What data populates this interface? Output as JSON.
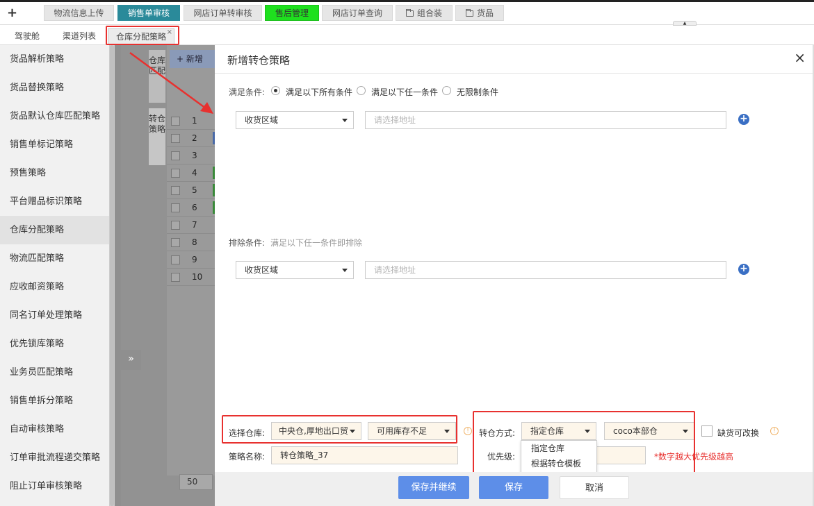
{
  "toolbar": {
    "add_label": "+"
  },
  "top_tabs": [
    {
      "label": "物流信息上传",
      "bg": "#e6e6e6",
      "color": "#555"
    },
    {
      "label": "销售单审核",
      "bg": "#2a8a9a",
      "color": "#ffffff"
    },
    {
      "label": "网店订单转审核",
      "bg": "#e6e6e6",
      "color": "#555"
    },
    {
      "label": "售后管理",
      "bg": "#1ee01e",
      "color": "#333"
    },
    {
      "label": "网店订单查询",
      "bg": "#e6e6e6",
      "color": "#555"
    },
    {
      "label": "组合装",
      "icon": "folder-icon"
    },
    {
      "label": "货品",
      "icon": "folder-icon"
    }
  ],
  "sub_tabs": [
    {
      "label": "驾驶舱"
    },
    {
      "label": "渠道列表"
    },
    {
      "label": "仓库分配策略",
      "close": "×"
    }
  ],
  "sidebar": {
    "items": [
      {
        "label": "货品解析策略"
      },
      {
        "label": "货品替换策略"
      },
      {
        "label": "货品默认仓库匹配策略"
      },
      {
        "label": "销售单标记策略"
      },
      {
        "label": "预售策略"
      },
      {
        "label": "平台赠品标识策略"
      },
      {
        "label": "仓库分配策略",
        "active": true
      },
      {
        "label": "物流匹配策略"
      },
      {
        "label": "应收邮资策略"
      },
      {
        "label": "同名订单处理策略"
      },
      {
        "label": "优先锁库策略"
      },
      {
        "label": "业务员匹配策略"
      },
      {
        "label": "销售单拆分策略"
      },
      {
        "label": "自动审核策略"
      },
      {
        "label": "订单审批流程递交策略"
      },
      {
        "label": "阻止订单审核策略"
      }
    ],
    "expand_label": "»"
  },
  "background": {
    "vtab1": "仓库匹配",
    "vtab2": "转仓策略",
    "new_label": "+ 新增",
    "rows": [
      "1",
      "2",
      "3",
      "4",
      "5",
      "6",
      "7",
      "8",
      "9",
      "10"
    ],
    "page_size": "50"
  },
  "dialog": {
    "title": "新增转仓策略",
    "close": "×",
    "meet": {
      "label": "满足条件:",
      "options": [
        "满足以下所有条件",
        "满足以下任一条件",
        "无限制条件"
      ],
      "selected": 0,
      "field": "收货区域",
      "placeholder": "请选择地址"
    },
    "exclude": {
      "label": "排除条件:",
      "hint": "满足以下任一条件即排除",
      "field": "收货区域",
      "placeholder": "请选择地址"
    },
    "warehouse": {
      "label": "选择仓库:",
      "value": "中央仓,厚地出口贸",
      "stock_condition": "可用库存不足"
    },
    "transfer": {
      "label": "转仓方式:",
      "value": "指定仓库",
      "target": "coco本部仓",
      "options": [
        "指定仓库",
        "根据转仓模板"
      ]
    },
    "allow_swap_label": "缺货可改换",
    "name": {
      "label": "策略名称:",
      "value": "转仓策略_37"
    },
    "priority": {
      "label": "优先级:",
      "hint": "*数字越大优先级越高"
    },
    "buttons": {
      "save_continue": "保存并继续",
      "save": "保存",
      "cancel": "取消"
    }
  },
  "colors": {
    "accent": "#5d8ee8",
    "annotation": "#e8312f",
    "hint": "#e8312f"
  }
}
